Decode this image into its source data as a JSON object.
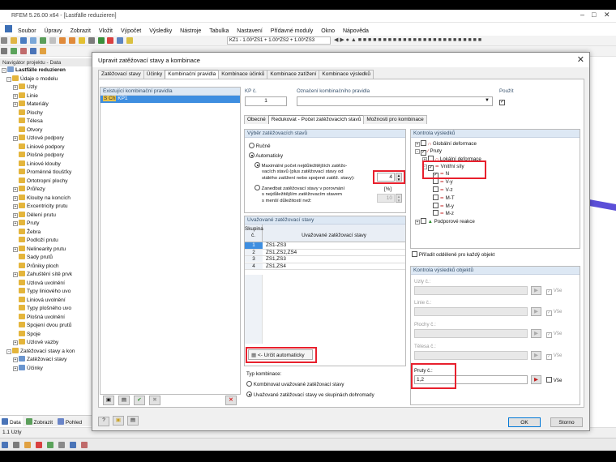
{
  "app": {
    "title": "RFEM 5.26.00 x64 - [Lastfälle reduzieren]"
  },
  "menu": [
    "Soubor",
    "Úpravy",
    "Zobrazit",
    "Vložit",
    "Výpočet",
    "Výsledky",
    "Nástroje",
    "Tabulka",
    "Nastavení",
    "Přídavné moduly",
    "Okno",
    "Nápověda"
  ],
  "toolbar": {
    "combo_value": "KZ1 - 1.00*ZS1 + 1.00*ZS2 + 1.00*ZS3"
  },
  "navigator": {
    "header": "Navigátor projektu - Data",
    "items": [
      "Lastfälle reduzieren",
      "Údaje o modelu",
      "Uzly",
      "Linie",
      "Materiály",
      "Plochy",
      "Tělesa",
      "Otvory",
      "Uzlové podpory",
      "Liniové podpory",
      "Plošné podpory",
      "Liniové klouby",
      "Proměnné tloušťky",
      "Ortotropní plochy",
      "Průřezy",
      "Klouby na koncích",
      "Excentricity prutu",
      "Dělení prutu",
      "Pruty",
      "Žebra",
      "Podloží prutu",
      "Nelinearity prutu",
      "Sady prutů",
      "Průniky ploch",
      "Zahuštění sítě prvk",
      "Uzlová uvolnění",
      "Typy liniového uvo",
      "Liniová uvolnění",
      "Typy plošného uvo",
      "Plošná uvolnění",
      "Spojení dvou prutů",
      "Spoje",
      "Uzlové vazby",
      "Zatěžovací stavy a kon",
      "Zatěžovací stavy",
      "Účinky"
    ],
    "tabs": [
      "Data",
      "Zobrazit",
      "Pohled"
    ]
  },
  "status": {
    "left": "1.1 Uzly"
  },
  "dialog": {
    "title": "Upravit zatěžovací stavy a kombinace",
    "tabs": [
      "Zatěžovací stavy",
      "Účinky",
      "Kombinační pravidla",
      "Kombinace účinků",
      "Kombinace zatížení",
      "Kombinace výsledků"
    ],
    "existing_header": "Existující kombinační pravidla",
    "existing_item_tag": "S Ch",
    "existing_item": "KP1",
    "kp_label": "KP č.",
    "kp_value": "1",
    "name_label": "Označení kombinačního pravidla",
    "use_label": "Použít",
    "subtabs": [
      "Obecné",
      "Redukovat - Počet zatěžovacích stavů",
      "Možnosti pro kombinace"
    ],
    "selection": {
      "header": "Výběr zatěžovacích stavů",
      "manual": "Ručně",
      "automatic": "Automaticky",
      "max_line1": "Maximální počet nejdůležitějších zatěžo-",
      "max_line2": "vacích stavů (plus zatěžovací stavy od",
      "max_line3": "stálého zatížení nebo spojené zatěž. stavy):",
      "max_value": "4",
      "neglect_line1": "Zanedbat zatěžovací stavy v porovnání",
      "neglect_line2": "s nejdůležitějším zatěžovacím stavem",
      "neglect_line3": "s menší důležitostí než:",
      "percent_unit": "[%]",
      "percent_value": "10"
    },
    "considered": {
      "header": "Uvažované zatěžovací stavy",
      "col_group_1": "Skupina",
      "col_group_2": "č.",
      "col_states": "Uvažované zatěžovací stavy",
      "rows": [
        {
          "no": "1",
          "states": "ZS1-ZS3"
        },
        {
          "no": "2",
          "states": "ZS1,ZS2,ZS4"
        },
        {
          "no": "3",
          "states": "ZS1,ZS3"
        },
        {
          "no": "4",
          "states": "ZS1,ZS4"
        }
      ],
      "auto_button": "<- Určit automaticky"
    },
    "combination_type": {
      "header": "Typ kombinace:",
      "opt1": "Kombinovat uvažované zatěžovací stavy",
      "opt2": "Uvažované zatěžovací stavy ve skupinách dohromady"
    },
    "results_check": {
      "header": "Kontrola výsledků",
      "tree": [
        "Globální deformace",
        "Pruty",
        "Lokální deformace",
        "Vnitřní síly",
        "N",
        "V-y",
        "V-z",
        "M-T",
        "M-y",
        "M-z",
        "Podporové reakce"
      ],
      "assign_label": "Přiřadit odděleně pro každý objekt"
    },
    "objects_check": {
      "header": "Kontrola výsledků objektů",
      "nodes": "Uzly č.:",
      "lines": "Linie č.:",
      "surfaces": "Plochy č.:",
      "solids": "Tělesa č.:",
      "members": "Pruty č.:",
      "members_value": "1,2",
      "all_label": "Vše"
    },
    "ok": "OK",
    "cancel": "Storno"
  }
}
